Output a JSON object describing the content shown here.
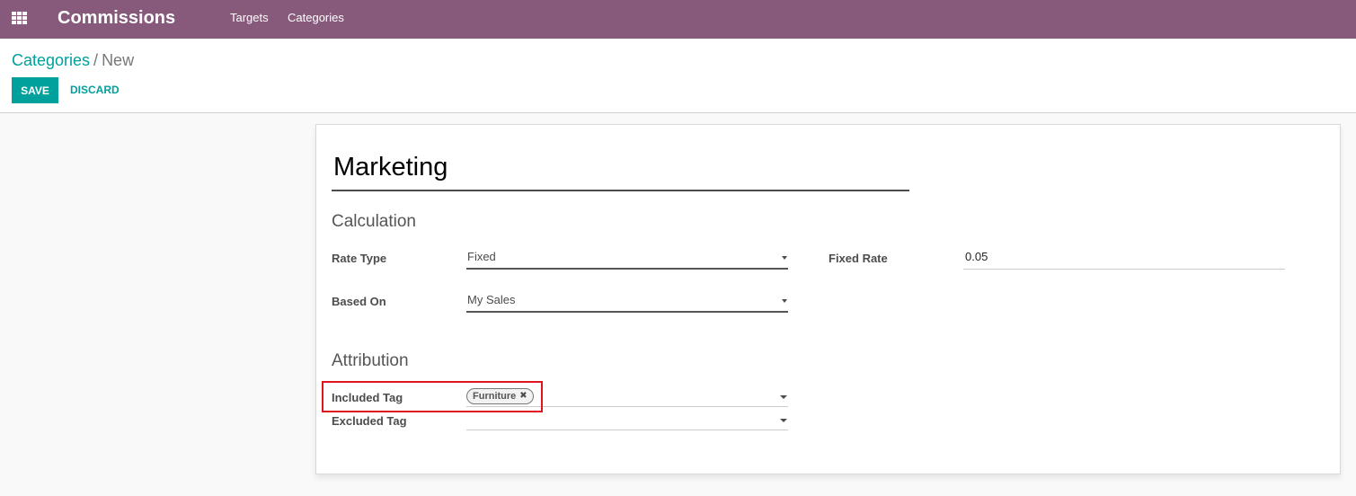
{
  "navbar": {
    "app_title": "Commissions",
    "menu": [
      "Targets",
      "Categories"
    ]
  },
  "breadcrumb": {
    "parent": "Categories",
    "separator": "/",
    "current": "New"
  },
  "actions": {
    "save": "SAVE",
    "discard": "DISCARD"
  },
  "form": {
    "name": "Marketing",
    "calculation": {
      "title": "Calculation",
      "rate_type_label": "Rate Type",
      "rate_type_value": "Fixed",
      "fixed_rate_label": "Fixed Rate",
      "fixed_rate_value": "0.05",
      "based_on_label": "Based On",
      "based_on_value": "My Sales"
    },
    "attribution": {
      "title": "Attribution",
      "included_tag_label": "Included Tag",
      "included_tags": [
        "Furniture"
      ],
      "excluded_tag_label": "Excluded Tag"
    }
  },
  "colors": {
    "navbar": "#875a7b",
    "accent": "#00a09d",
    "highlight": "#e0161e"
  }
}
